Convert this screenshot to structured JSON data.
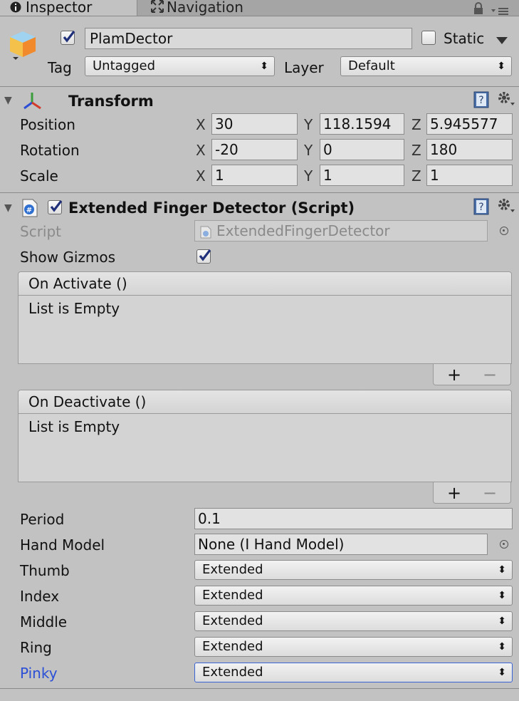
{
  "tabs": [
    {
      "label": "Inspector",
      "icon": "info-icon"
    },
    {
      "label": "Navigation",
      "icon": "navigation-icon"
    }
  ],
  "header_icons": [
    "lock-icon",
    "menu-icon"
  ],
  "gameobject": {
    "icon": "cube-icon",
    "active": true,
    "name": "PlamDector",
    "static_label": "Static",
    "static_checked": false,
    "tag_label": "Tag",
    "tag_value": "Untagged",
    "layer_label": "Layer",
    "layer_value": "Default"
  },
  "transform": {
    "title": "Transform",
    "icon": "transform-axes-icon",
    "rows": [
      {
        "label": "Position",
        "x": "30",
        "y": "118.1594",
        "z": "5.945577"
      },
      {
        "label": "Rotation",
        "x": "-20",
        "y": "0",
        "z": "180"
      },
      {
        "label": "Scale",
        "x": "1",
        "y": "1",
        "z": "1"
      }
    ],
    "axis_labels": {
      "x": "X",
      "y": "Y",
      "z": "Z"
    }
  },
  "component": {
    "title": "Extended Finger Detector (Script)",
    "icon": "csharp-script-icon",
    "enabled": true,
    "script_label": "Script",
    "script_value": "ExtendedFingerDetector",
    "show_gizmos_label": "Show Gizmos",
    "show_gizmos_checked": true,
    "on_activate": {
      "title": "On Activate ()",
      "body": "List is Empty"
    },
    "on_deactivate": {
      "title": "On Deactivate ()",
      "body": "List is Empty"
    },
    "plus": "+",
    "minus": "−",
    "period_label": "Period",
    "period_value": "0.1",
    "hand_model_label": "Hand Model",
    "hand_model_value": "None (I Hand Model)",
    "fingers": [
      {
        "label": "Thumb",
        "value": "Extended"
      },
      {
        "label": "Index",
        "value": "Extended"
      },
      {
        "label": "Middle",
        "value": "Extended"
      },
      {
        "label": "Ring",
        "value": "Extended"
      },
      {
        "label": "Pinky",
        "value": "Extended"
      }
    ]
  },
  "colors": {
    "selected_label": "#2b4fd6",
    "selected_border": "#3a63d4"
  }
}
